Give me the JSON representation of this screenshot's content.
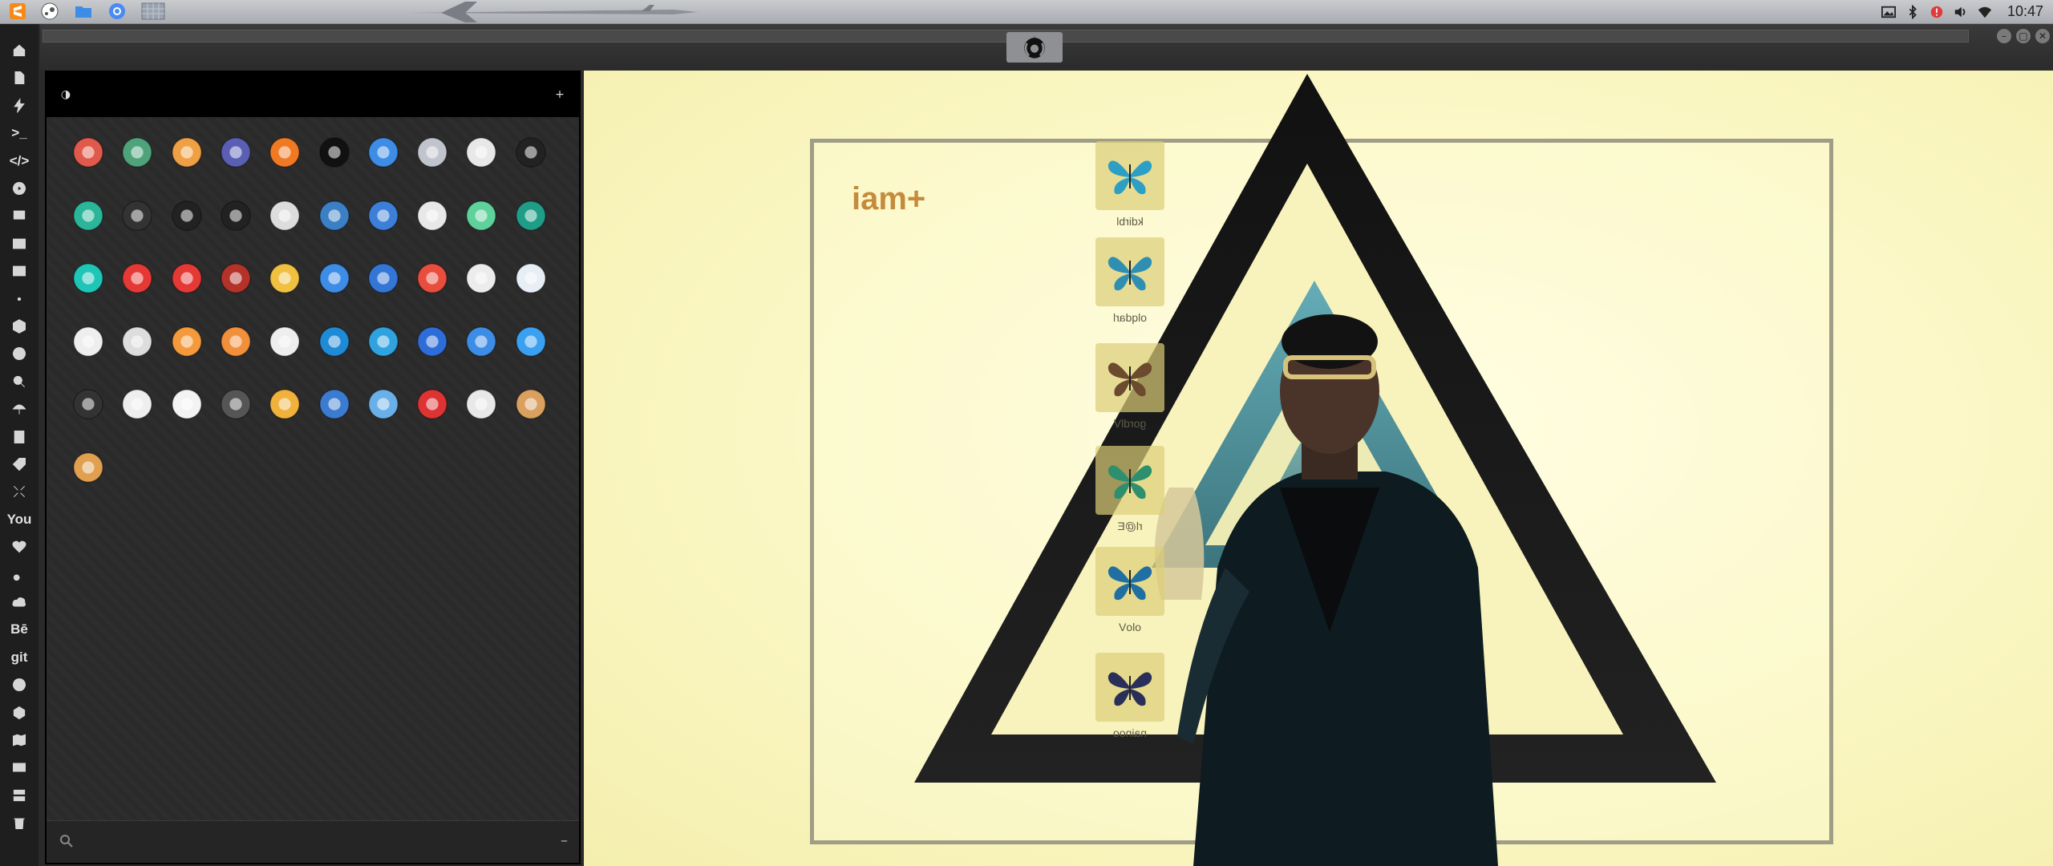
{
  "topbar": {
    "apps": [
      {
        "name": "sublime-text-icon",
        "color": "#f58a19"
      },
      {
        "name": "steam-icon",
        "color": "#8a8a8a"
      },
      {
        "name": "files-icon",
        "color": "#3d8ce6"
      },
      {
        "name": "chrome-icon",
        "color": "#4a8af4"
      },
      {
        "name": "workspace-icon",
        "color": "#9aa3b0"
      }
    ],
    "clock": "10:47"
  },
  "launcher": {
    "search_placeholder": "",
    "apps": [
      [
        "warning",
        "yandex",
        "magnifier",
        "hourglass",
        "arrow",
        "terminal",
        "globe",
        "drive",
        "window",
        "chat"
      ],
      [
        "vpn",
        "github-cat",
        "starfleet",
        "death-star",
        "inkscape",
        "map",
        "books",
        "notes",
        "music",
        "video"
      ],
      [
        "play",
        "youtube",
        "close-red",
        "ironman",
        "c3po",
        "translate",
        "calculator",
        "photos",
        "flask",
        "powershell"
      ],
      [
        "document",
        "news",
        "pages",
        "picture",
        "presentation",
        "vscode",
        "snowflake",
        "disk-utility",
        "umbrella",
        "cloud"
      ],
      [
        "equalizer",
        "rss",
        "calendar",
        "clock",
        "kanban",
        "earth",
        "mail",
        "gmail",
        "google-drive",
        "pyramid"
      ],
      [
        "radio"
      ]
    ]
  },
  "wallpaper": {
    "brand": "iam+",
    "tiles": [
      {
        "label": "kdirbl",
        "color": "#2e9fc4"
      },
      {
        "label": "olqdarl",
        "color": "#2f8fb3"
      },
      {
        "label": "gordlV",
        "color": "#6b4a2e"
      },
      {
        "label": "rl@E",
        "color": "#2e8f6e"
      },
      {
        "label": "oloV",
        "color": "#1f6fa3"
      },
      {
        "label": "nainoo",
        "color": "#2a2f5a"
      }
    ]
  },
  "colors": {
    "accent_orange": "#f58a19",
    "wallpaper_bg": "#fbf7c4",
    "panel_bg": "#2a2a2a"
  }
}
